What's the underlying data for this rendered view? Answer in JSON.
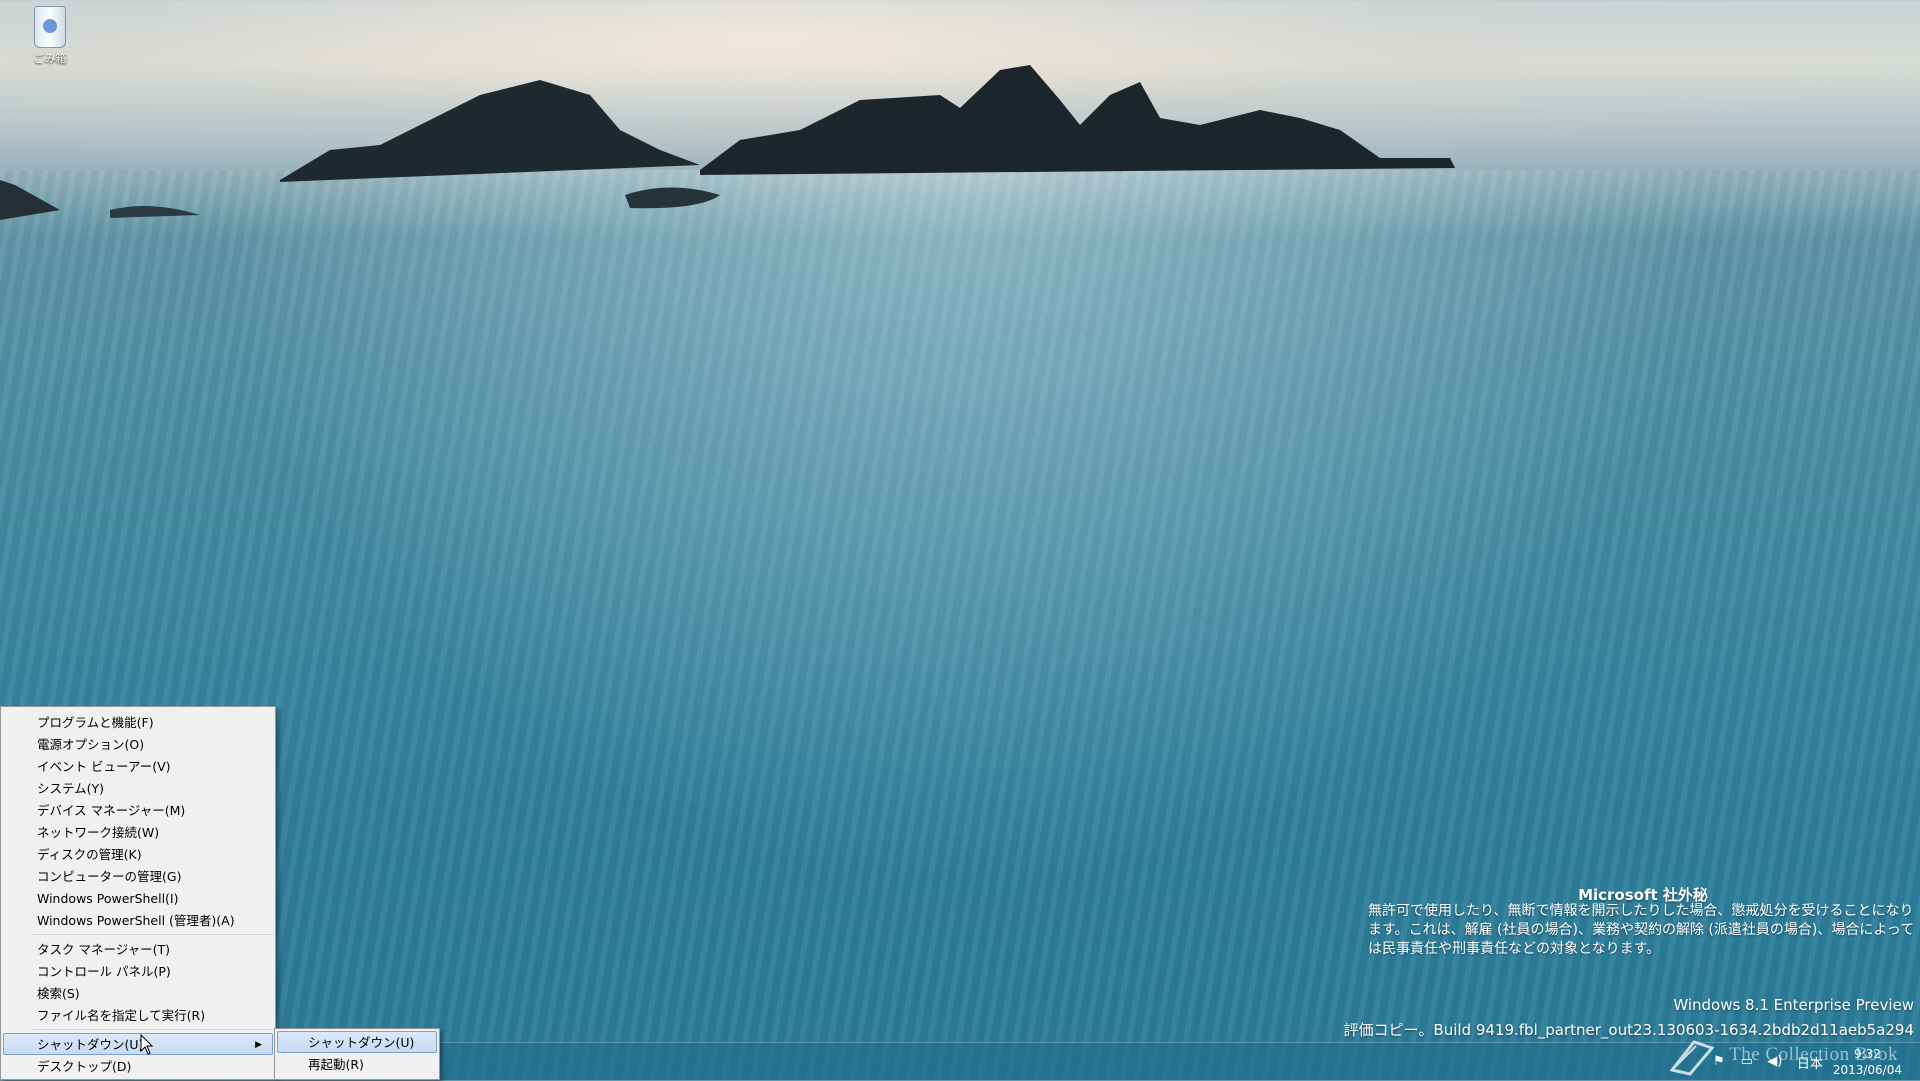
{
  "desktop": {
    "recycle_bin_label": "ごみ箱"
  },
  "watermark": {
    "title": "Microsoft 社外秘",
    "body": "無許可で使用したり、無断で情報を開示したりした場合、懲戒処分を受けることになります。これは、解雇 (社員の場合)、業務や契約の解除 (派遣社員の場合)、場合によっては民事責任や刑事責任などの対象となります。",
    "edition": "Windows 8.1 Enterprise Preview",
    "build": "評価コピー。Build 9419.fbl_partner_out23.130603-1634.2bdb2d11aeb5a294"
  },
  "context_menu": {
    "group1": [
      "プログラムと機能(F)",
      "電源オプション(O)",
      "イベント ビューアー(V)",
      "システム(Y)",
      "デバイス マネージャー(M)",
      "ネットワーク接続(W)",
      "ディスクの管理(K)",
      "コンピューターの管理(G)",
      "Windows PowerShell(I)",
      "Windows PowerShell (管理者)(A)"
    ],
    "group2": [
      "タスク マネージャー(T)",
      "コントロール パネル(P)",
      "検索(S)",
      "ファイル名を指定して実行(R)"
    ],
    "shutdown": "シャットダウン(U)",
    "desktop": "デスクトップ(D)"
  },
  "submenu": {
    "shutdown": "シャットダウン(U)",
    "restart": "再起動(R)"
  },
  "taskbar": {
    "language": "日本",
    "time": "9:32",
    "date": "2013/06/04",
    "overlay_text": "The Collection Book"
  }
}
